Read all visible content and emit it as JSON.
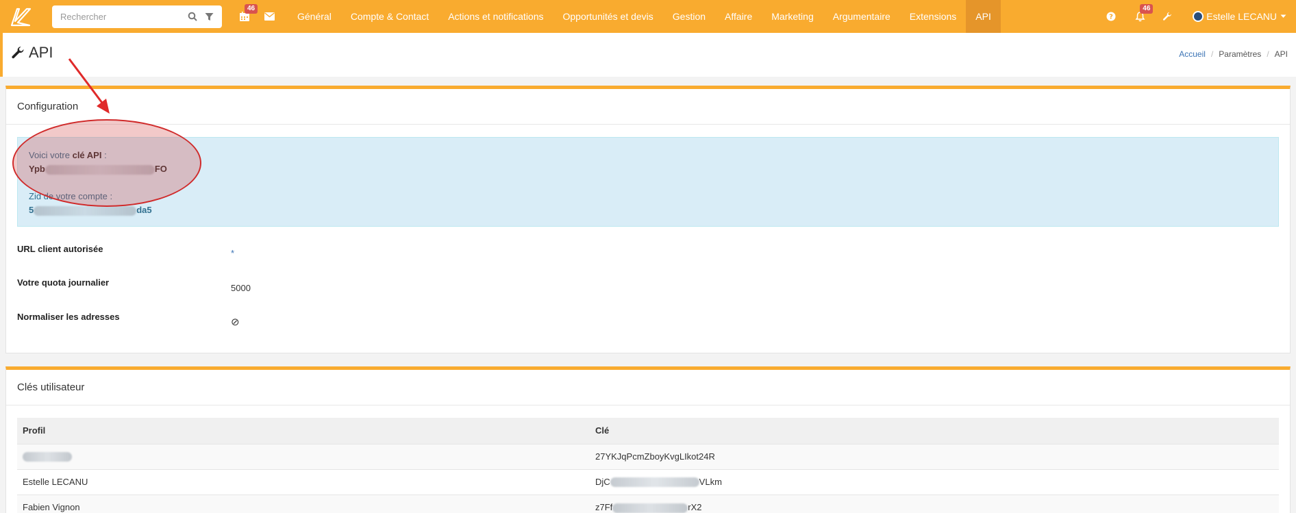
{
  "navbar": {
    "search_placeholder": "Rechercher",
    "calendar_badge": "46",
    "notifications_badge": "46",
    "menu": [
      {
        "label": "Général"
      },
      {
        "label": "Compte & Contact"
      },
      {
        "label": "Actions et notifications"
      },
      {
        "label": "Opportunités et devis"
      },
      {
        "label": "Gestion"
      },
      {
        "label": "Affaire"
      },
      {
        "label": "Marketing"
      },
      {
        "label": "Argumentaire"
      },
      {
        "label": "Extensions"
      },
      {
        "label": "API"
      }
    ],
    "active_menu": "API",
    "user_name": "Estelle LECANU",
    "accent_color": "#f9ab2f"
  },
  "page": {
    "title": "API",
    "breadcrumb": [
      "Accueil",
      "Paramètres",
      "API"
    ]
  },
  "configuration": {
    "heading": "Configuration",
    "api_key_prefix": "Voici votre ",
    "api_key_label": "clé API",
    "api_key_suffix": " :",
    "api_key_start": "Ypb",
    "api_key_end": "FO",
    "zid_label": "Zid de votre compte :",
    "zid_start": "5",
    "zid_end": "da5",
    "rows": [
      {
        "label": "URL client autorisée",
        "value": "*"
      },
      {
        "label": "Votre quota journalier",
        "value": "5000"
      },
      {
        "label": "Normaliser les adresses",
        "value": "⊘"
      }
    ]
  },
  "user_keys": {
    "heading": "Clés utilisateur",
    "columns": [
      "Profil",
      "Clé"
    ],
    "rows": [
      {
        "profile": "",
        "key": "27YKJqPcmZboyKvgLIkot24R"
      },
      {
        "profile": "Estelle LECANU",
        "key_start": "DjC",
        "key_end": "VLkm"
      },
      {
        "profile": "Fabien Vignon",
        "key_start": "z7Ff",
        "key_end": "rX2"
      }
    ]
  }
}
